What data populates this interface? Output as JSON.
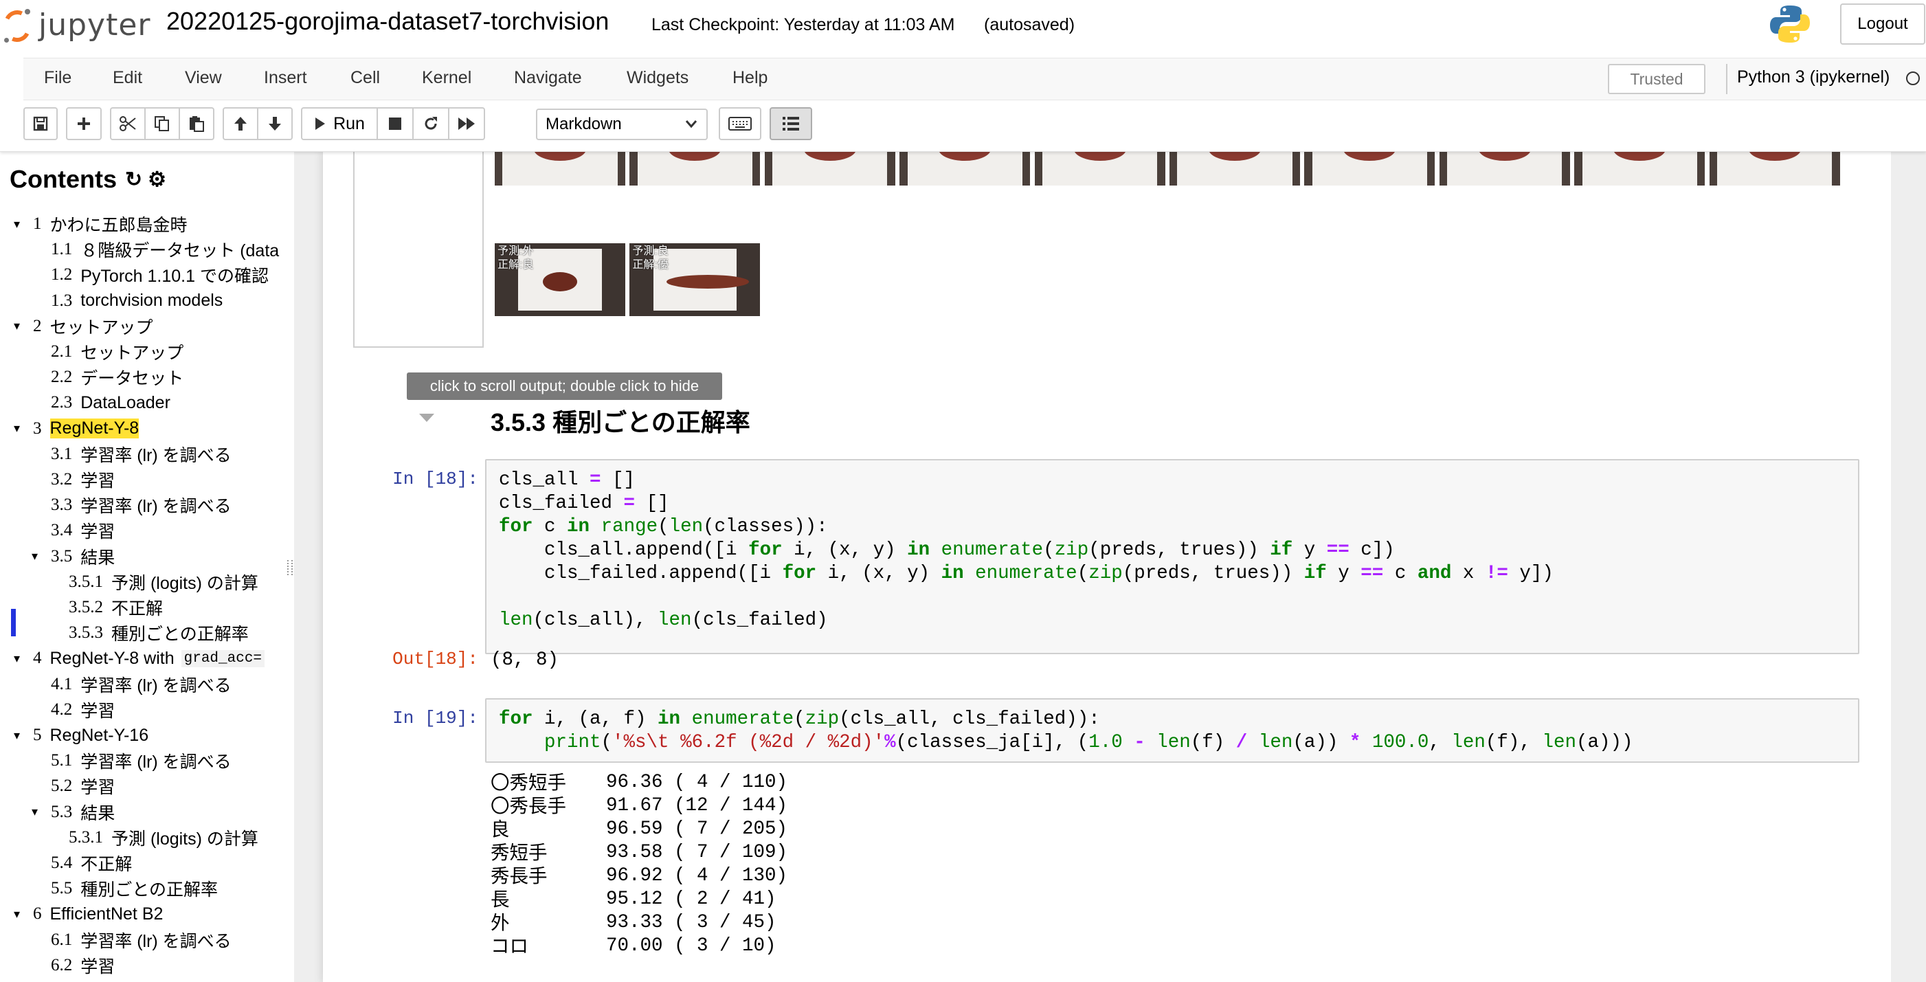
{
  "app": {
    "logo_text": "jupyter",
    "notebook_title": "20220125-gorojima-dataset7-torchvision",
    "checkpoint": "Last Checkpoint: Yesterday at 11:03 AM",
    "autosave": "(autosaved)",
    "logout_label": "Logout"
  },
  "menu": [
    "File",
    "Edit",
    "View",
    "Insert",
    "Cell",
    "Kernel",
    "Navigate",
    "Widgets",
    "Help"
  ],
  "status": {
    "trusted": "Trusted",
    "kernel": "Python 3 (ipykernel)"
  },
  "toolbar": {
    "buttons": [
      "save-icon",
      "add-cell-icon",
      "cut-icon",
      "copy-icon",
      "paste-icon",
      "move-up-icon",
      "move-down-icon",
      "run-icon",
      "stop-icon",
      "restart-icon",
      "fast-forward-icon",
      "keyboard-icon",
      "toc-list-icon"
    ],
    "run_label": "Run",
    "cell_type": "Markdown"
  },
  "toc": {
    "title": "Contents",
    "items": [
      {
        "num": "1",
        "label": "かわに五郎島金時",
        "level": 1,
        "toggle": true
      },
      {
        "num": "1.1",
        "label": "８階級データセット (data",
        "level": 2
      },
      {
        "num": "1.2",
        "label": "PyTorch 1.10.1 での確認",
        "level": 2
      },
      {
        "num": "1.3",
        "label": "torchvision models",
        "level": 2
      },
      {
        "num": "2",
        "label": "セットアップ",
        "level": 1,
        "toggle": true
      },
      {
        "num": "2.1",
        "label": "セットアップ",
        "level": 2
      },
      {
        "num": "2.2",
        "label": "データセット",
        "level": 2
      },
      {
        "num": "2.3",
        "label": "DataLoader",
        "level": 2
      },
      {
        "num": "3",
        "label": "RegNet-Y-8",
        "level": 1,
        "toggle": true,
        "highlight": true
      },
      {
        "num": "3.1",
        "label": "学習率 (lr) を調べる",
        "level": 2
      },
      {
        "num": "3.2",
        "label": "学習",
        "level": 2
      },
      {
        "num": "3.3",
        "label": "学習率 (lr) を調べる",
        "level": 2
      },
      {
        "num": "3.4",
        "label": "学習",
        "level": 2
      },
      {
        "num": "3.5",
        "label": "結果",
        "level": 2,
        "toggle": true
      },
      {
        "num": "3.5.1",
        "label": "予測 (logits) の計算",
        "level": 3
      },
      {
        "num": "3.5.2",
        "label": "不正解",
        "level": 3
      },
      {
        "num": "3.5.3",
        "label": "種別ごとの正解率",
        "level": 3
      },
      {
        "num": "4",
        "label": "RegNet-Y-8 with",
        "code": "grad_acc=",
        "level": 1,
        "toggle": true
      },
      {
        "num": "4.1",
        "label": "学習率 (lr) を調べる",
        "level": 2
      },
      {
        "num": "4.2",
        "label": "学習",
        "level": 2
      },
      {
        "num": "5",
        "label": "RegNet-Y-16",
        "level": 1,
        "toggle": true
      },
      {
        "num": "5.1",
        "label": "学習率 (lr) を調べる",
        "level": 2
      },
      {
        "num": "5.2",
        "label": "学習",
        "level": 2
      },
      {
        "num": "5.3",
        "label": "結果",
        "level": 2,
        "toggle": true
      },
      {
        "num": "5.3.1",
        "label": "予測 (logits) の計算",
        "level": 3
      },
      {
        "num": "5.4",
        "label": "不正解",
        "level": 2
      },
      {
        "num": "5.5",
        "label": "種別ごとの正解率",
        "level": 2
      },
      {
        "num": "6",
        "label": "EfficientNet B2",
        "level": 1,
        "toggle": true
      },
      {
        "num": "6.1",
        "label": "学習率 (lr) を調べる",
        "level": 2
      },
      {
        "num": "6.2",
        "label": "学習",
        "level": 2
      }
    ]
  },
  "notebook": {
    "thumb_labels": [
      {
        "pred": "予測:外",
        "true": "正解:良"
      },
      {
        "pred": "予測:良",
        "true": "正解:優"
      }
    ],
    "tooltip": "click to scroll output; double click to hide",
    "section_heading": "3.5.3  種別ごとの正解率",
    "cell18_prompt": "In [18]:",
    "out18_prompt": "Out[18]:",
    "out18_value": "(8, 8)",
    "cell19_prompt": "In [19]:",
    "stats": [
      {
        "name": "〇秀短手",
        "value": "96.36 ( 4 / 110)"
      },
      {
        "name": "〇秀長手",
        "value": "91.67 (12 / 144)"
      },
      {
        "name": "良",
        "value": "96.59 ( 7 / 205)"
      },
      {
        "name": "秀短手",
        "value": "93.58 ( 7 / 109)"
      },
      {
        "name": "秀長手",
        "value": "96.92 ( 4 / 130)"
      },
      {
        "name": "長",
        "value": "95.12 ( 2 / 41)"
      },
      {
        "name": "外",
        "value": "93.33 ( 3 / 45)"
      },
      {
        "name": "コロ",
        "value": "70.00 ( 3 / 10)"
      }
    ]
  },
  "colors": {
    "jupyter_orange": "#f37726",
    "toc_highlight": "#ffe135",
    "in_prompt": "#303f9f",
    "out_prompt": "#d84315",
    "keyword_green": "#008000",
    "operator_purple": "#aa22ff",
    "string_red": "#ba2121"
  }
}
